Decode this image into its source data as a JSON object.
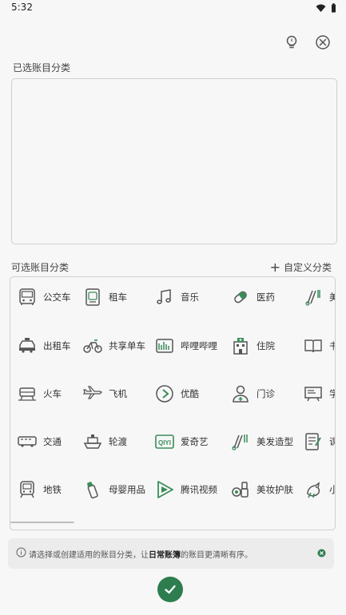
{
  "status": {
    "time": "5:32"
  },
  "selected": {
    "label": "已选账目分类"
  },
  "available": {
    "label": "可选账目分类",
    "custom_label": "自定义分类",
    "items": [
      {
        "name": "bus",
        "label": "公交车"
      },
      {
        "name": "rental-car",
        "label": "租车"
      },
      {
        "name": "music",
        "label": "音乐"
      },
      {
        "name": "medicine",
        "label": "医药"
      },
      {
        "name": "beauty",
        "label": "美"
      },
      {
        "name": "taxi",
        "label": "出租车"
      },
      {
        "name": "bike",
        "label": "共享单车"
      },
      {
        "name": "bilibili",
        "label": "哔哩哔哩"
      },
      {
        "name": "hospital",
        "label": "住院"
      },
      {
        "name": "book",
        "label": "书"
      },
      {
        "name": "train",
        "label": "火车"
      },
      {
        "name": "plane",
        "label": "飞机"
      },
      {
        "name": "youku",
        "label": "优酷"
      },
      {
        "name": "clinic",
        "label": "门诊"
      },
      {
        "name": "school",
        "label": "学"
      },
      {
        "name": "traffic",
        "label": "交通"
      },
      {
        "name": "ferry",
        "label": "轮渡"
      },
      {
        "name": "iqiyi",
        "label": "爱奇艺"
      },
      {
        "name": "hairdressing",
        "label": "美发造型"
      },
      {
        "name": "course",
        "label": "课"
      },
      {
        "name": "subway",
        "label": "地铁"
      },
      {
        "name": "baby",
        "label": "母婴用品"
      },
      {
        "name": "tencent-video",
        "label": "腾讯视频"
      },
      {
        "name": "cosmetics",
        "label": "美妆护肤"
      },
      {
        "name": "small",
        "label": "小"
      }
    ]
  },
  "info": {
    "text_pre": "请选择或创建适用的账目分类，让",
    "text_bold": "日常账簿",
    "text_post": "的账目更清晰有序。"
  },
  "colors": {
    "accent": "#2e7d4f",
    "icon_green": "#3a8d5a",
    "icon_gray": "#555555"
  }
}
